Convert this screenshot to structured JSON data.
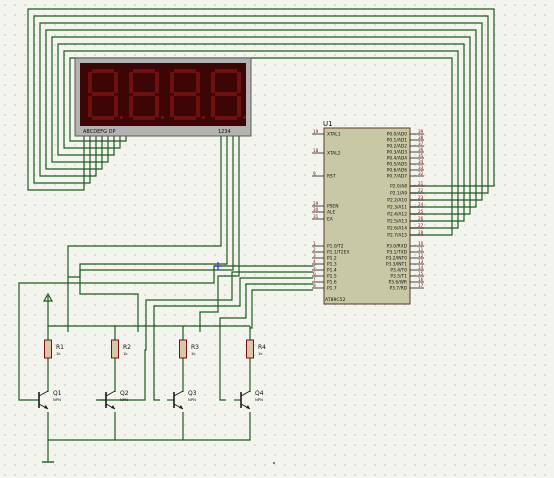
{
  "display": {
    "segment_label": "ABCDEFG DP",
    "digit_label": "1234"
  },
  "mcu": {
    "ref": "U1",
    "part": "AT89C52",
    "left_pins": [
      {
        "num": "19",
        "name": "XTAL1"
      },
      {
        "num": "18",
        "name": "XTAL2"
      },
      {
        "num": "9",
        "name": "RST"
      },
      {
        "num": "29",
        "name": "PSEN"
      },
      {
        "num": "30",
        "name": "ALE"
      },
      {
        "num": "31",
        "name": "EA"
      },
      {
        "num": "1",
        "name": "P1.0/T2"
      },
      {
        "num": "2",
        "name": "P1.1/T2EX"
      },
      {
        "num": "3",
        "name": "P1.2"
      },
      {
        "num": "4",
        "name": "P1.3"
      },
      {
        "num": "5",
        "name": "P1.4"
      },
      {
        "num": "6",
        "name": "P1.5"
      },
      {
        "num": "7",
        "name": "P1.6"
      },
      {
        "num": "8",
        "name": "P1.7"
      }
    ],
    "right_pins": [
      {
        "num": "39",
        "name": "P0.0/AD0"
      },
      {
        "num": "38",
        "name": "P0.1/AD1"
      },
      {
        "num": "37",
        "name": "P0.2/AD2"
      },
      {
        "num": "36",
        "name": "P0.3/AD3"
      },
      {
        "num": "35",
        "name": "P0.4/AD4"
      },
      {
        "num": "34",
        "name": "P0.5/AD5"
      },
      {
        "num": "33",
        "name": "P0.6/AD6"
      },
      {
        "num": "32",
        "name": "P0.7/AD7"
      },
      {
        "num": "21",
        "name": "P2.0/A8"
      },
      {
        "num": "22",
        "name": "P2.1/A9"
      },
      {
        "num": "23",
        "name": "P2.2/A10"
      },
      {
        "num": "24",
        "name": "P2.3/A11"
      },
      {
        "num": "25",
        "name": "P2.4/A12"
      },
      {
        "num": "26",
        "name": "P2.5/A13"
      },
      {
        "num": "27",
        "name": "P2.6/A14"
      },
      {
        "num": "28",
        "name": "P2.7/A15"
      },
      {
        "num": "10",
        "name": "P3.0/RXD"
      },
      {
        "num": "11",
        "name": "P3.1/TXD"
      },
      {
        "num": "12",
        "name": "P3.2/INT0"
      },
      {
        "num": "13",
        "name": "P3.3/INT1"
      },
      {
        "num": "14",
        "name": "P3.4/T0"
      },
      {
        "num": "15",
        "name": "P3.5/T1"
      },
      {
        "num": "16",
        "name": "P3.6/WR"
      },
      {
        "num": "17",
        "name": "P3.7/RD"
      }
    ]
  },
  "resistors": [
    {
      "ref": "R1",
      "value": "1k"
    },
    {
      "ref": "R2",
      "value": "1k"
    },
    {
      "ref": "R3",
      "value": "1k"
    },
    {
      "ref": "R4",
      "value": "1k"
    }
  ],
  "transistors": [
    {
      "ref": "Q1",
      "type": "NPN"
    },
    {
      "ref": "Q2",
      "type": "NPN"
    },
    {
      "ref": "Q3",
      "type": "NPN"
    },
    {
      "ref": "Q4",
      "type": "NPN"
    }
  ]
}
